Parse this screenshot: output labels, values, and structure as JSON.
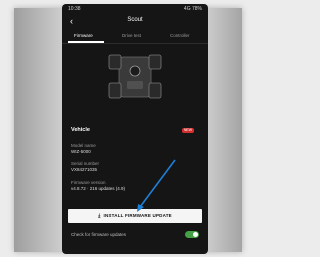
{
  "status_bar": {
    "left": "10:38",
    "center": "",
    "right": "4G 78%"
  },
  "header": {
    "title": "Scout",
    "back_icon": "back-arrow-icon"
  },
  "tabs": [
    {
      "label": "Firmware",
      "active": true
    },
    {
      "label": "Drive test",
      "active": false
    },
    {
      "label": "Controller",
      "active": false
    }
  ],
  "section": {
    "title": "Vehicle",
    "badge": "NEW"
  },
  "info": [
    {
      "label": "Model name",
      "value": "WIZ-5000"
    },
    {
      "label": "Serial number",
      "value": "VX84271035"
    },
    {
      "label": "Firmware version",
      "value": "v4.8.72 · 216 updates (4.9)"
    }
  ],
  "install_button": {
    "label": "INSTALL FIRMWARE UPDATE",
    "icon": "download-icon"
  },
  "auto_update": {
    "label": "Check for firmware updates",
    "enabled": true
  },
  "colors": {
    "accent_red": "#d32f2f",
    "toggle_green": "#43a047",
    "arrow_blue": "#1e7fd6"
  }
}
